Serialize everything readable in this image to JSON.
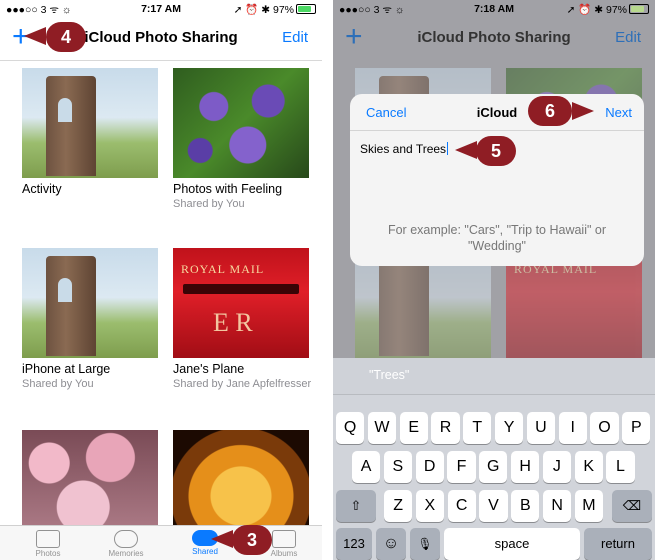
{
  "left": {
    "status": {
      "left": "●●●○○ 3 ᯤ ☼",
      "time": "7:17 AM",
      "right": "➚ ⏰ ✱ 97%"
    },
    "nav": {
      "add": "+",
      "title": "iCloud Photo Sharing",
      "edit": "Edit"
    },
    "albums": [
      {
        "name": "Activity",
        "sub": ""
      },
      {
        "name": "Photos with Feeling",
        "sub": "Shared by You"
      },
      {
        "name": "iPhone at Large",
        "sub": "Shared by You"
      },
      {
        "name": "Jane's Plane",
        "sub": "Shared by Jane Apfelfresser"
      }
    ],
    "mailbox_text": "ROYAL MAIL",
    "mailbox_cypher": "E R",
    "tabs": [
      {
        "label": "Photos"
      },
      {
        "label": "Memories"
      },
      {
        "label": "Shared"
      },
      {
        "label": "Albums"
      }
    ],
    "callouts": {
      "c4": "4",
      "c3": "3"
    }
  },
  "right": {
    "status": {
      "left": "●●●○○ 3 ᯤ ☼",
      "time": "7:18 AM",
      "right": "➚ ⏰ ✱ 97%"
    },
    "nav": {
      "add": "+",
      "title": "iCloud Photo Sharing",
      "edit": "Edit"
    },
    "dialog": {
      "cancel": "Cancel",
      "title": "iCloud",
      "next": "Next",
      "value": "Skies and Trees",
      "hint": "For example: \"Cars\", \"Trip to Hawaii\" or \"Wedding\""
    },
    "mailbox_text": "ROYAL MAIL",
    "suggestion": "\"Trees\"",
    "keyboard": {
      "row1": [
        "Q",
        "W",
        "E",
        "R",
        "T",
        "Y",
        "U",
        "I",
        "O",
        "P"
      ],
      "row2": [
        "A",
        "S",
        "D",
        "F",
        "G",
        "H",
        "J",
        "K",
        "L"
      ],
      "row3": [
        "Z",
        "X",
        "C",
        "V",
        "B",
        "N",
        "M"
      ],
      "shift": "⇧",
      "backspace": "⌫",
      "numbers": "123",
      "emoji": "☺",
      "mic": "🎙",
      "space": "space",
      "return": "return"
    },
    "callouts": {
      "c6": "6",
      "c5": "5"
    }
  }
}
